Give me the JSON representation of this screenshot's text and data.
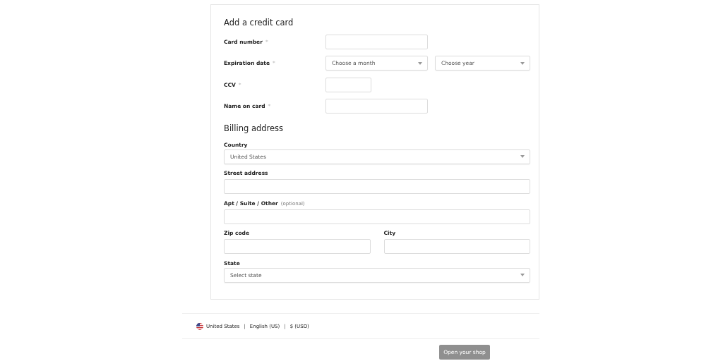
{
  "card": {
    "title": "Add a credit card",
    "fields": [
      {
        "label": "Card number",
        "mark": "*",
        "controls": [
          {
            "kind": "input"
          }
        ]
      },
      {
        "label": "Expiration date",
        "mark": "*",
        "controls": [
          {
            "kind": "select",
            "placeholder": "Choose a month"
          },
          {
            "kind": "select",
            "placeholder": "Choose year"
          }
        ]
      },
      {
        "label": "CCV",
        "mark": "*",
        "controls": [
          {
            "kind": "input"
          }
        ]
      },
      {
        "label": "Name on card",
        "mark": "*",
        "controls": [
          {
            "kind": "input"
          }
        ]
      }
    ]
  },
  "billing": {
    "title": "Billing address",
    "rows": [
      [
        {
          "label": "Country",
          "kind": "select",
          "value": "United States"
        }
      ],
      [
        {
          "label": "Street address",
          "kind": "input"
        }
      ],
      [
        {
          "label": "Apt / Suite / Other",
          "note": "(optional)",
          "kind": "input"
        }
      ],
      [
        {
          "label": "Zip code",
          "kind": "input"
        },
        {
          "label": "City",
          "kind": "input"
        }
      ],
      [
        {
          "label": "State",
          "kind": "select",
          "placeholder": "Select state"
        }
      ]
    ]
  },
  "footer": {
    "items": [
      "United States",
      "English (US)",
      "$ (USD)"
    ],
    "separator": "|"
  },
  "button": {
    "label": "Open your shop",
    "disabled": true
  }
}
